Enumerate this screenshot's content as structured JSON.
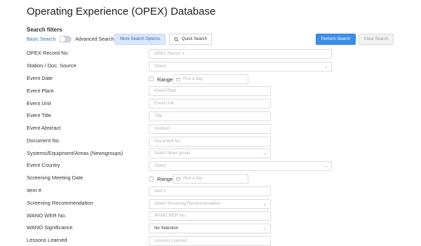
{
  "page": {
    "title": "Operating Experience (OPEX) Database"
  },
  "filters": {
    "heading": "Search filters",
    "basic_label": "Basic Search",
    "advanced_label": "Advanced Search",
    "advanced_enabled": false,
    "more_options_label": "More Search Options",
    "quick_search_label": "Quick Search",
    "perform_label": "Perform Search",
    "clear_label": "Clear Search"
  },
  "fields": {
    "opex_record_no": {
      "label": "OPEX Record No",
      "placeholder": "OPEX Record #"
    },
    "station": {
      "label": "Station / Doc. Source",
      "placeholder": "Select"
    },
    "event_date": {
      "label": "Event Date",
      "range_label": "Range",
      "placeholder": "Pick a day"
    },
    "event_plant": {
      "label": "Event Plant",
      "placeholder": "Event Plant"
    },
    "event_unit": {
      "label": "Event Unit",
      "placeholder": "Event Unit"
    },
    "event_title": {
      "label": "Event Title",
      "placeholder": "Title"
    },
    "event_abstract": {
      "label": "Event Abstract",
      "placeholder": "Abstract"
    },
    "document_no": {
      "label": "Document No.",
      "placeholder": "Document No"
    },
    "systems": {
      "label": "Systems/Equipment/Areas (Newsgroups)",
      "placeholder": "Select News group"
    },
    "event_country": {
      "label": "Event Country",
      "placeholder": "Select"
    },
    "screening_date": {
      "label": "Screening Meeting Date",
      "range_label": "Range",
      "placeholder": "Pick a day"
    },
    "item_no": {
      "label": "Item #",
      "placeholder": "Item #"
    },
    "screening_rec": {
      "label": "Screening Recommendation",
      "placeholder": "Select Screening Recommendation"
    },
    "wano_wer": {
      "label": "WANO WER No.",
      "placeholder": "WANO WER No."
    },
    "wano_significance": {
      "label": "WANO Significance",
      "value": "No Selection"
    },
    "lessons_learned": {
      "label": "Lessons Learned",
      "placeholder": "Lessons Learned"
    }
  },
  "icons": {
    "search": "search-icon",
    "calendar": "calendar-icon",
    "chevron": "chevron-down-icon"
  },
  "colors": {
    "primary": "#3d8ee8",
    "link": "#2979c9",
    "more_options_bg": "#dbe8fb"
  }
}
